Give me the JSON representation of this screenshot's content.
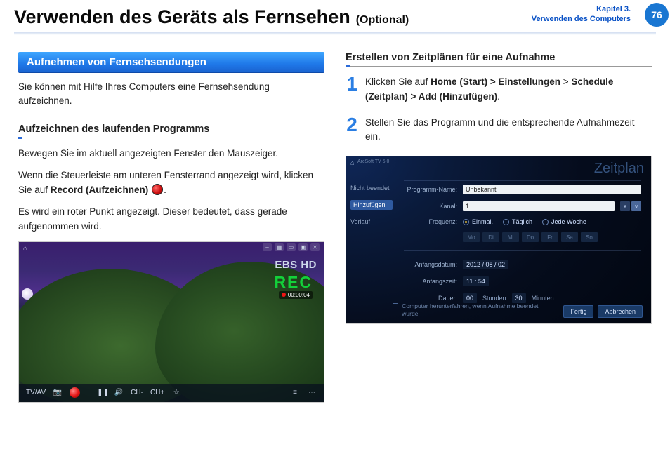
{
  "header": {
    "title": "Verwenden des Geräts als Fernsehen",
    "optional": "(Optional)",
    "chapter_line1": "Kapitel 3.",
    "chapter_line2": "Verwenden des Computers",
    "page_number": "76"
  },
  "left": {
    "section_header": "Aufnehmen von Fernsehsendungen",
    "lead": "Sie können mit Hilfe Ihres Computers eine Fernsehsendung aufzeichnen.",
    "subheading": "Aufzeichnen des laufenden Programms",
    "p1": "Bewegen Sie im aktuell angezeigten Fenster den Mauszeiger.",
    "p2a": "Wenn die Steuerleiste am unteren Fensterrand angezeigt wird, klicken Sie auf ",
    "p2b_bold": "Record (Aufzeichnen)",
    "p2c": ".",
    "p3": "Es wird ein roter Punkt angezeigt. Dieser bedeutet, dass gerade aufgenommen wird."
  },
  "tv": {
    "channel": "EBS HD",
    "rec": "REC",
    "rec_time": "00:00:04",
    "tvav": "TV/AV",
    "chminus": "CH-",
    "chplus": "CH+"
  },
  "right": {
    "subheading": "Erstellen von Zeitplänen für eine Aufnahme",
    "step1_a": "Klicken Sie auf ",
    "step1_b": "Home (Start) > Einstellungen",
    "step1_c": " > ",
    "step1_d": "Schedule (Zeitplan) > Add (Hinzufügen)",
    "step1_e": ".",
    "step2": "Stellen Sie das Programm und die entsprechende Aufnahmezeit ein.",
    "num1": "1",
    "num2": "2"
  },
  "sched": {
    "title": "Zeitplan",
    "app": "ArcSoft TV 5.0",
    "side": {
      "i0": "Nicht beendet",
      "i1": "Hinzufügen",
      "i2": "Verlauf"
    },
    "labels": {
      "prog": "Programm-Name:",
      "kanal": "Kanal:",
      "freq": "Frequenz:",
      "sdate": "Anfangsdatum:",
      "stime": "Anfangszeit:",
      "dur": "Dauer:"
    },
    "values": {
      "prog": "Unbekannt",
      "kanal": "1",
      "date": "2012 / 08 / 02",
      "time": "11 : 54",
      "dur_h": "00",
      "dur_m": "30"
    },
    "freq_opts": {
      "once": "Einmal.",
      "daily": "Täglich",
      "weekly": "Jede Woche"
    },
    "days": {
      "mo": "Mo",
      "di": "Di",
      "mi": "Mi",
      "do": "Do",
      "fr": "Fr",
      "sa": "Sa",
      "so": "So"
    },
    "units": {
      "h": "Stunden",
      "m": "Minuten"
    },
    "shutdown": "Computer herunterfahren, wenn Aufnahme beendet wurde",
    "actions": {
      "ok": "Fertig",
      "cancel": "Abbrechen"
    }
  }
}
